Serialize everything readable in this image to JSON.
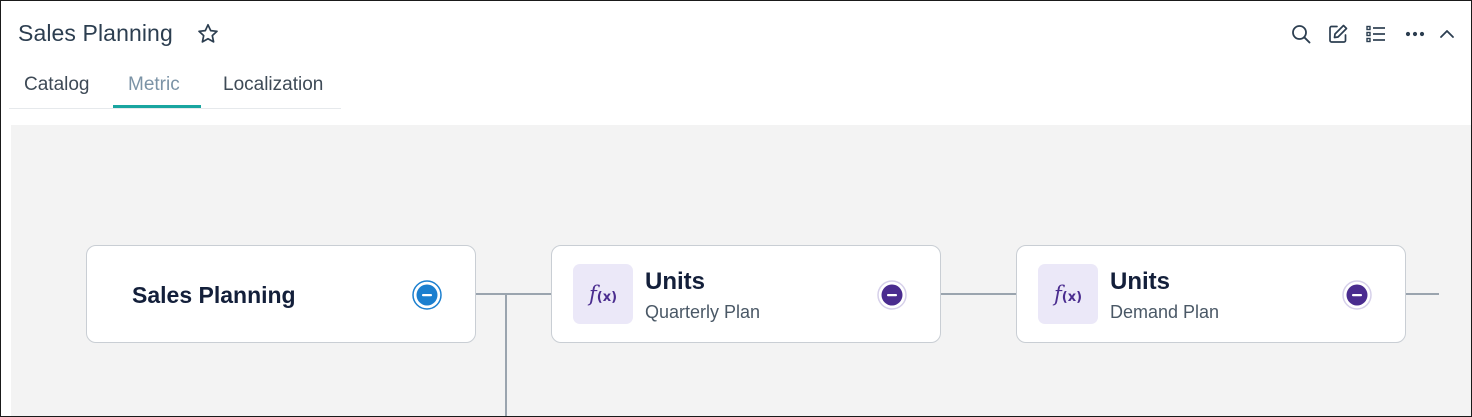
{
  "header": {
    "title": "Sales Planning",
    "icons": [
      "star-icon",
      "search-icon",
      "edit-icon",
      "list-icon",
      "more-icon",
      "chevron-up-icon"
    ]
  },
  "tabs": [
    {
      "label": "Catalog",
      "active": false
    },
    {
      "label": "Metric",
      "active": true
    },
    {
      "label": "Localization",
      "active": false
    }
  ],
  "colors": {
    "active_tab_underline": "#19a5a0",
    "root_collapse": "#1b7fcf",
    "metric_collapse": "#4a2c8f",
    "fx_background": "#ebe8f8"
  },
  "graph": {
    "root": {
      "label": "Sales Planning"
    },
    "nodes": [
      {
        "title": "Units",
        "subtitle": "Quarterly Plan",
        "icon": "fx-icon"
      },
      {
        "title": "Units",
        "subtitle": "Demand Plan",
        "icon": "fx-icon"
      }
    ]
  }
}
